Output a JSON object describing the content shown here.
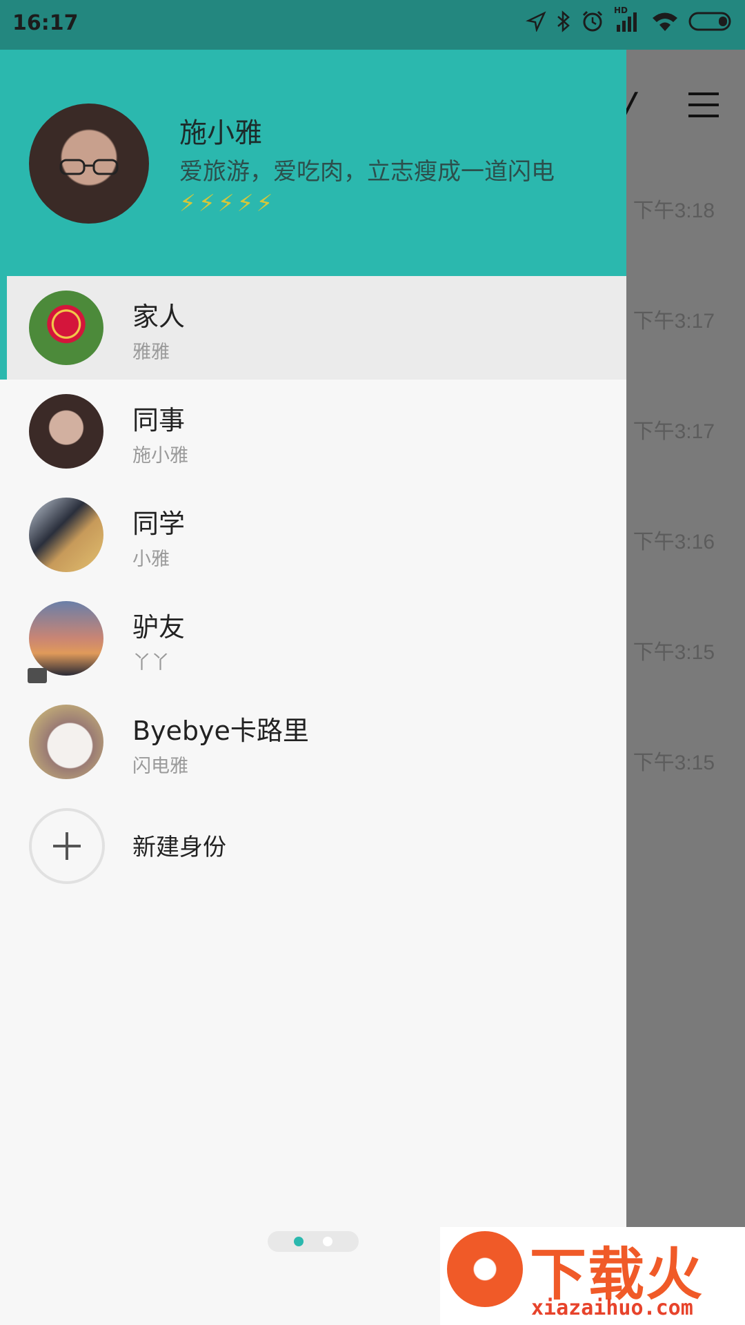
{
  "status_bar": {
    "time": "16:17",
    "icons": [
      "location-icon",
      "bluetooth-icon",
      "alarm-icon",
      "hd-signal-icon",
      "wifi-icon",
      "battery-icon"
    ],
    "signal_label": "HD"
  },
  "background_app": {
    "times": [
      "下午3:18",
      "下午3:17",
      "下午3:17",
      "下午3:16",
      "下午3:15",
      "下午3:15"
    ]
  },
  "profile": {
    "name": "施小雅",
    "bio": "爱旅游，爱吃肉，立志瘦成一道闪电",
    "bolts": "⚡⚡⚡⚡⚡"
  },
  "identities": [
    {
      "name": "家人",
      "sub": "雅雅",
      "active": true
    },
    {
      "name": "同事",
      "sub": "施小雅",
      "active": false
    },
    {
      "name": "同学",
      "sub": "小雅",
      "active": false
    },
    {
      "name": "驴友",
      "sub": "丫丫",
      "active": false
    },
    {
      "name": "Byebye卡路里",
      "sub": "闪电雅",
      "active": false
    }
  ],
  "add_identity_label": "新建身份",
  "watermark": {
    "title": "下载火",
    "url": "xiazaihuo.com"
  },
  "colors": {
    "accent": "#2bb8ae",
    "status_bar": "#23877f"
  }
}
